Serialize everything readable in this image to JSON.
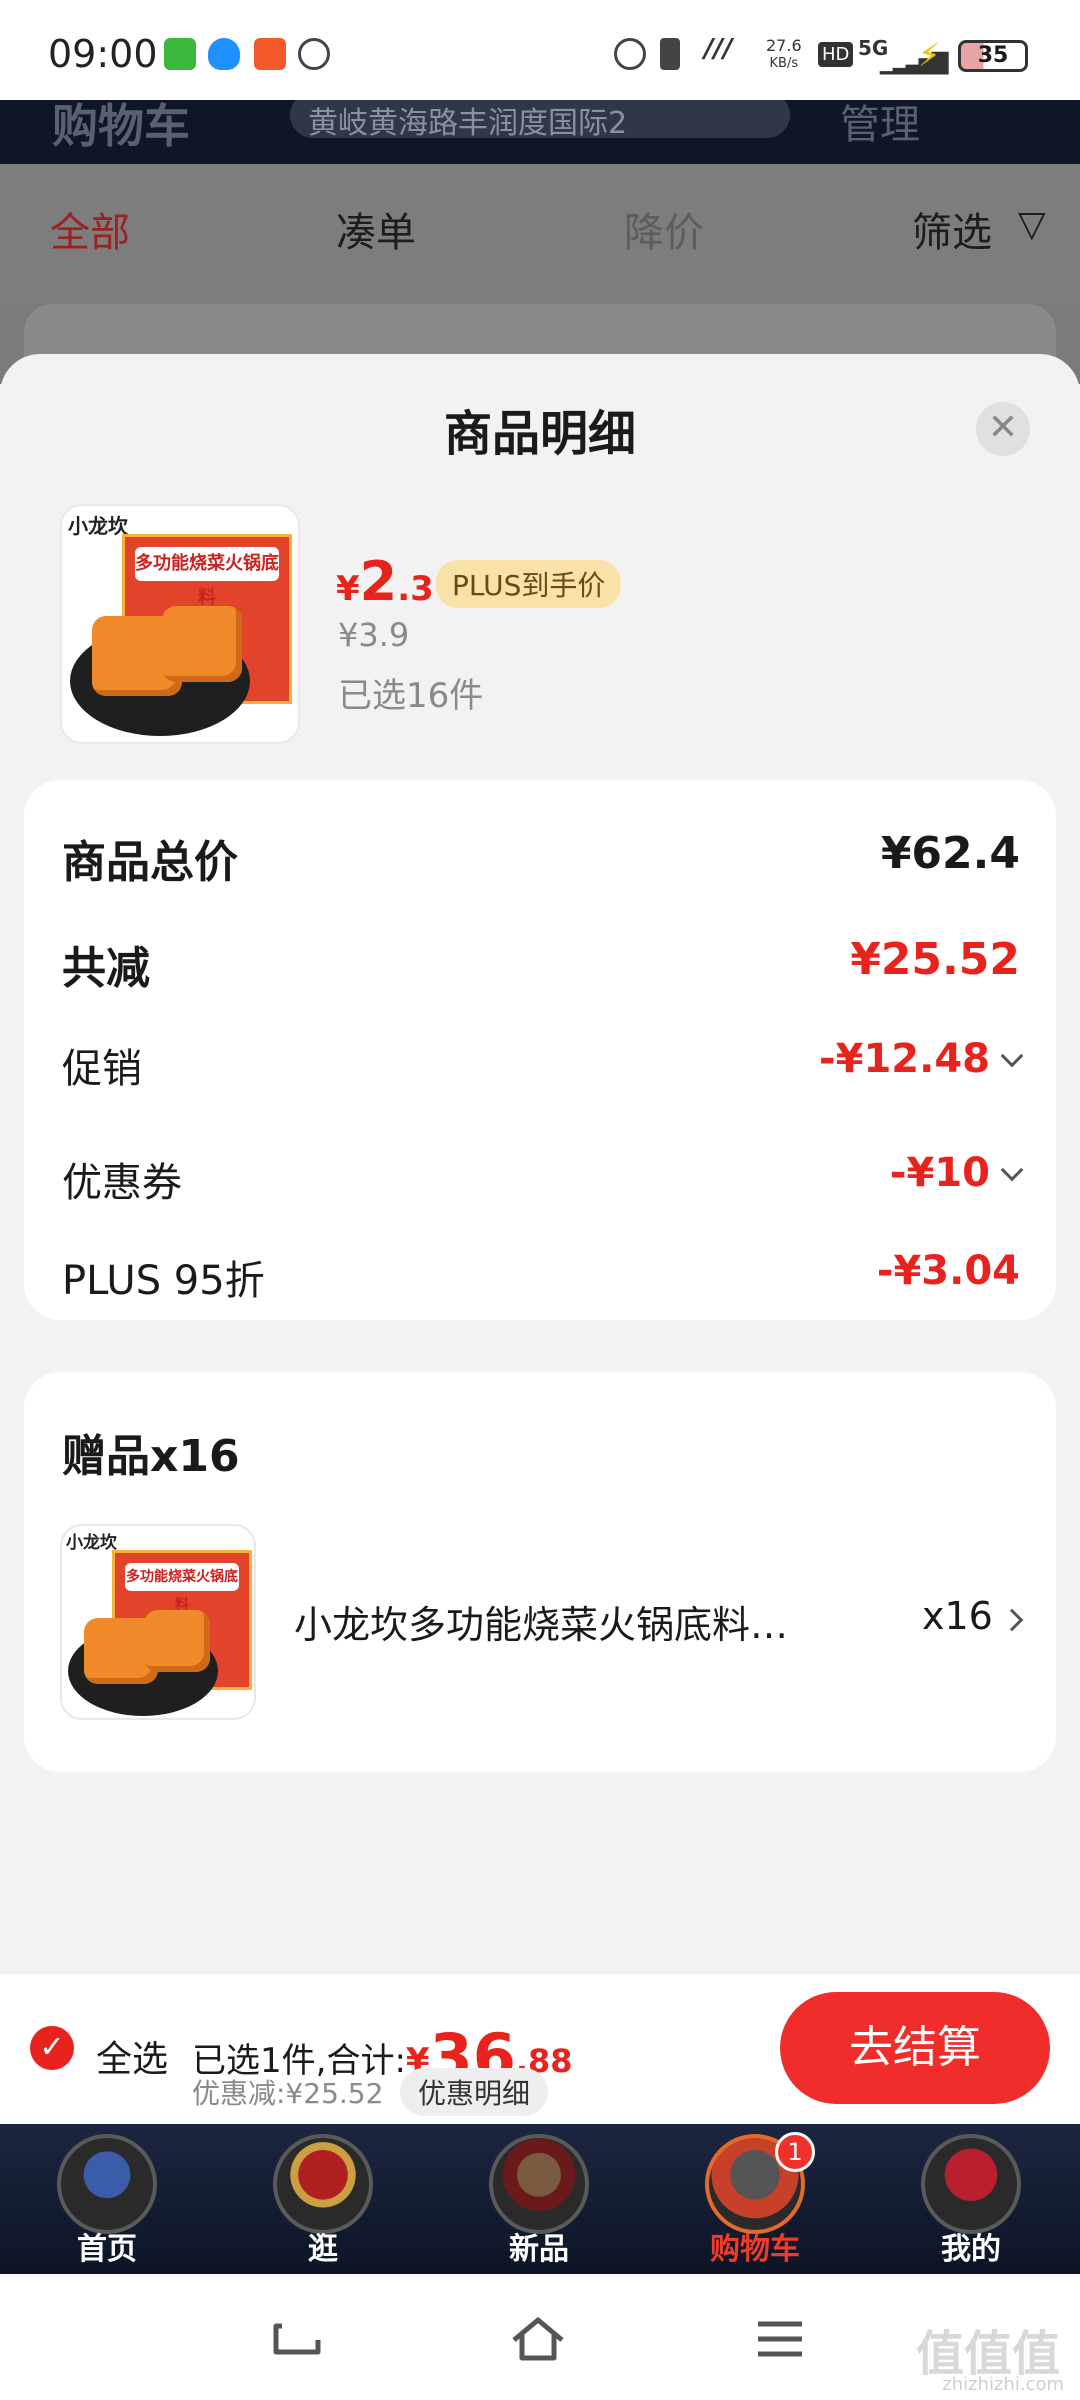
{
  "status_bar": {
    "time": "09:00",
    "speed": "27.6",
    "speed_unit": "KB/s",
    "hd": "HD",
    "network": "5G",
    "battery": "35"
  },
  "background": {
    "header_title": "购物车",
    "address": "黄岐黄海路丰润度国际2",
    "manage": "管理",
    "tabs": [
      "全部",
      "凑单",
      "降价",
      "筛选"
    ]
  },
  "sheet": {
    "title": "商品明细",
    "product": {
      "brand": "小龙坎",
      "pkg_label": "多功能烧菜火锅底料",
      "price_symbol": "¥",
      "price_int": "2",
      "price_dec": ".3",
      "plus_badge": "PLUS到手价",
      "orig_price": "¥3.9",
      "selected": "已选16件"
    },
    "summary": {
      "total_label": "商品总价",
      "total_value": "¥62.4",
      "reduce_label": "共减",
      "reduce_value": "¥25.52",
      "promo_label": "促销",
      "promo_value": "-¥12.48",
      "coupon_label": "优惠券",
      "coupon_value": "-¥10",
      "plus_label": "PLUS 95折",
      "plus_value": "-¥3.04"
    },
    "gift": {
      "title": "赠品x16",
      "name": "小龙坎多功能烧菜火锅底料…",
      "qty": "x16"
    }
  },
  "checkout": {
    "select_all": "全选",
    "summary_prefix": "已选1件,合计:",
    "total_symbol": "¥",
    "total_int": "36",
    "total_dec": ".88",
    "discount_text": "优惠减:¥25.52",
    "discount_detail": "优惠明细",
    "pay_label": "去结算"
  },
  "nav": {
    "items": [
      "首页",
      "逛",
      "新品",
      "购物车",
      "我的"
    ],
    "cart_badge": "1"
  },
  "watermark": {
    "big": "值值值",
    "small": "zhizhizhi.com"
  },
  "colors": {
    "accent": "#e8231e",
    "nav_bg": "#0d1426",
    "sheet_bg": "#f2f2f2"
  }
}
